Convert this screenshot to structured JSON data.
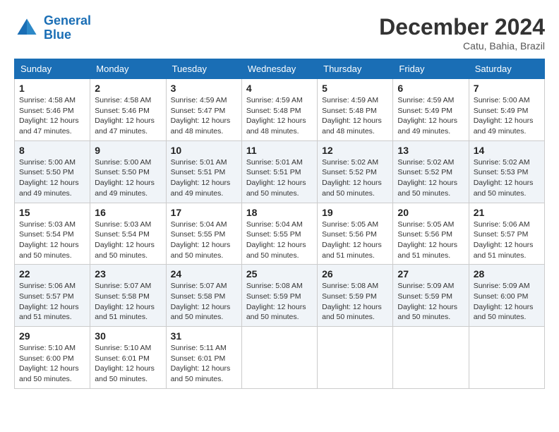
{
  "header": {
    "logo_line1": "General",
    "logo_line2": "Blue",
    "month": "December 2024",
    "location": "Catu, Bahia, Brazil"
  },
  "weekdays": [
    "Sunday",
    "Monday",
    "Tuesday",
    "Wednesday",
    "Thursday",
    "Friday",
    "Saturday"
  ],
  "weeks": [
    [
      {
        "day": "1",
        "sunrise": "4:58 AM",
        "sunset": "5:46 PM",
        "daylight": "12 hours and 47 minutes."
      },
      {
        "day": "2",
        "sunrise": "4:58 AM",
        "sunset": "5:46 PM",
        "daylight": "12 hours and 47 minutes."
      },
      {
        "day": "3",
        "sunrise": "4:59 AM",
        "sunset": "5:47 PM",
        "daylight": "12 hours and 48 minutes."
      },
      {
        "day": "4",
        "sunrise": "4:59 AM",
        "sunset": "5:48 PM",
        "daylight": "12 hours and 48 minutes."
      },
      {
        "day": "5",
        "sunrise": "4:59 AM",
        "sunset": "5:48 PM",
        "daylight": "12 hours and 48 minutes."
      },
      {
        "day": "6",
        "sunrise": "4:59 AM",
        "sunset": "5:49 PM",
        "daylight": "12 hours and 49 minutes."
      },
      {
        "day": "7",
        "sunrise": "5:00 AM",
        "sunset": "5:49 PM",
        "daylight": "12 hours and 49 minutes."
      }
    ],
    [
      {
        "day": "8",
        "sunrise": "5:00 AM",
        "sunset": "5:50 PM",
        "daylight": "12 hours and 49 minutes."
      },
      {
        "day": "9",
        "sunrise": "5:00 AM",
        "sunset": "5:50 PM",
        "daylight": "12 hours and 49 minutes."
      },
      {
        "day": "10",
        "sunrise": "5:01 AM",
        "sunset": "5:51 PM",
        "daylight": "12 hours and 49 minutes."
      },
      {
        "day": "11",
        "sunrise": "5:01 AM",
        "sunset": "5:51 PM",
        "daylight": "12 hours and 50 minutes."
      },
      {
        "day": "12",
        "sunrise": "5:02 AM",
        "sunset": "5:52 PM",
        "daylight": "12 hours and 50 minutes."
      },
      {
        "day": "13",
        "sunrise": "5:02 AM",
        "sunset": "5:52 PM",
        "daylight": "12 hours and 50 minutes."
      },
      {
        "day": "14",
        "sunrise": "5:02 AM",
        "sunset": "5:53 PM",
        "daylight": "12 hours and 50 minutes."
      }
    ],
    [
      {
        "day": "15",
        "sunrise": "5:03 AM",
        "sunset": "5:54 PM",
        "daylight": "12 hours and 50 minutes."
      },
      {
        "day": "16",
        "sunrise": "5:03 AM",
        "sunset": "5:54 PM",
        "daylight": "12 hours and 50 minutes."
      },
      {
        "day": "17",
        "sunrise": "5:04 AM",
        "sunset": "5:55 PM",
        "daylight": "12 hours and 50 minutes."
      },
      {
        "day": "18",
        "sunrise": "5:04 AM",
        "sunset": "5:55 PM",
        "daylight": "12 hours and 50 minutes."
      },
      {
        "day": "19",
        "sunrise": "5:05 AM",
        "sunset": "5:56 PM",
        "daylight": "12 hours and 51 minutes."
      },
      {
        "day": "20",
        "sunrise": "5:05 AM",
        "sunset": "5:56 PM",
        "daylight": "12 hours and 51 minutes."
      },
      {
        "day": "21",
        "sunrise": "5:06 AM",
        "sunset": "5:57 PM",
        "daylight": "12 hours and 51 minutes."
      }
    ],
    [
      {
        "day": "22",
        "sunrise": "5:06 AM",
        "sunset": "5:57 PM",
        "daylight": "12 hours and 51 minutes."
      },
      {
        "day": "23",
        "sunrise": "5:07 AM",
        "sunset": "5:58 PM",
        "daylight": "12 hours and 51 minutes."
      },
      {
        "day": "24",
        "sunrise": "5:07 AM",
        "sunset": "5:58 PM",
        "daylight": "12 hours and 50 minutes."
      },
      {
        "day": "25",
        "sunrise": "5:08 AM",
        "sunset": "5:59 PM",
        "daylight": "12 hours and 50 minutes."
      },
      {
        "day": "26",
        "sunrise": "5:08 AM",
        "sunset": "5:59 PM",
        "daylight": "12 hours and 50 minutes."
      },
      {
        "day": "27",
        "sunrise": "5:09 AM",
        "sunset": "5:59 PM",
        "daylight": "12 hours and 50 minutes."
      },
      {
        "day": "28",
        "sunrise": "5:09 AM",
        "sunset": "6:00 PM",
        "daylight": "12 hours and 50 minutes."
      }
    ],
    [
      {
        "day": "29",
        "sunrise": "5:10 AM",
        "sunset": "6:00 PM",
        "daylight": "12 hours and 50 minutes."
      },
      {
        "day": "30",
        "sunrise": "5:10 AM",
        "sunset": "6:01 PM",
        "daylight": "12 hours and 50 minutes."
      },
      {
        "day": "31",
        "sunrise": "5:11 AM",
        "sunset": "6:01 PM",
        "daylight": "12 hours and 50 minutes."
      },
      null,
      null,
      null,
      null
    ]
  ],
  "labels": {
    "sunrise_prefix": "Sunrise: ",
    "sunset_prefix": "Sunset: ",
    "daylight_prefix": "Daylight: "
  }
}
